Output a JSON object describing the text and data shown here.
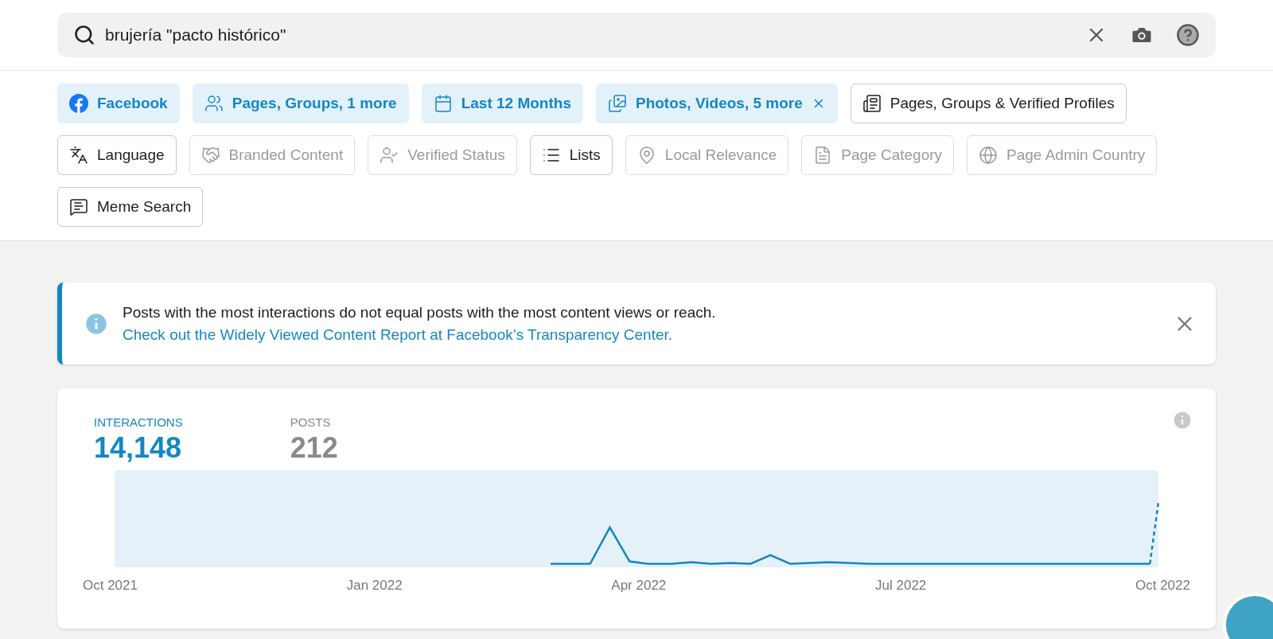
{
  "search": {
    "value": "brujería \"pacto histórico\""
  },
  "filters": [
    {
      "label": "Facebook",
      "kind": "active",
      "removable": false
    },
    {
      "label": "Pages, Groups, 1 more",
      "kind": "active",
      "removable": false
    },
    {
      "label": "Last 12 Months",
      "kind": "active",
      "removable": false
    },
    {
      "label": "Photos, Videos, 5 more",
      "kind": "active",
      "removable": true
    },
    {
      "label": "Pages, Groups & Verified Profiles",
      "kind": "outline",
      "removable": false
    },
    {
      "label": "Language",
      "kind": "outline",
      "removable": false
    },
    {
      "label": "Branded Content",
      "kind": "disabled",
      "removable": false
    },
    {
      "label": "Verified Status",
      "kind": "disabled",
      "removable": false
    },
    {
      "label": "Lists",
      "kind": "outline",
      "removable": false
    },
    {
      "label": "Local Relevance",
      "kind": "disabled",
      "removable": false
    },
    {
      "label": "Page Category",
      "kind": "disabled",
      "removable": false
    },
    {
      "label": "Page Admin Country",
      "kind": "disabled",
      "removable": false
    },
    {
      "label": "Meme Search",
      "kind": "outline",
      "removable": false
    }
  ],
  "notice": {
    "text": "Posts with the most interactions do not equal posts with the most content views or reach.",
    "link": "Check out the Widely Viewed Content Report at Facebook’s Transparency Center."
  },
  "stats": [
    {
      "label": "INTERACTIONS",
      "value": "14,148",
      "selected": true
    },
    {
      "label": "POSTS",
      "value": "212",
      "selected": false
    }
  ],
  "x_labels": [
    "Oct 2021",
    "Jan 2022",
    "Apr 2022",
    "Jul 2022",
    "Oct 2022"
  ]
}
